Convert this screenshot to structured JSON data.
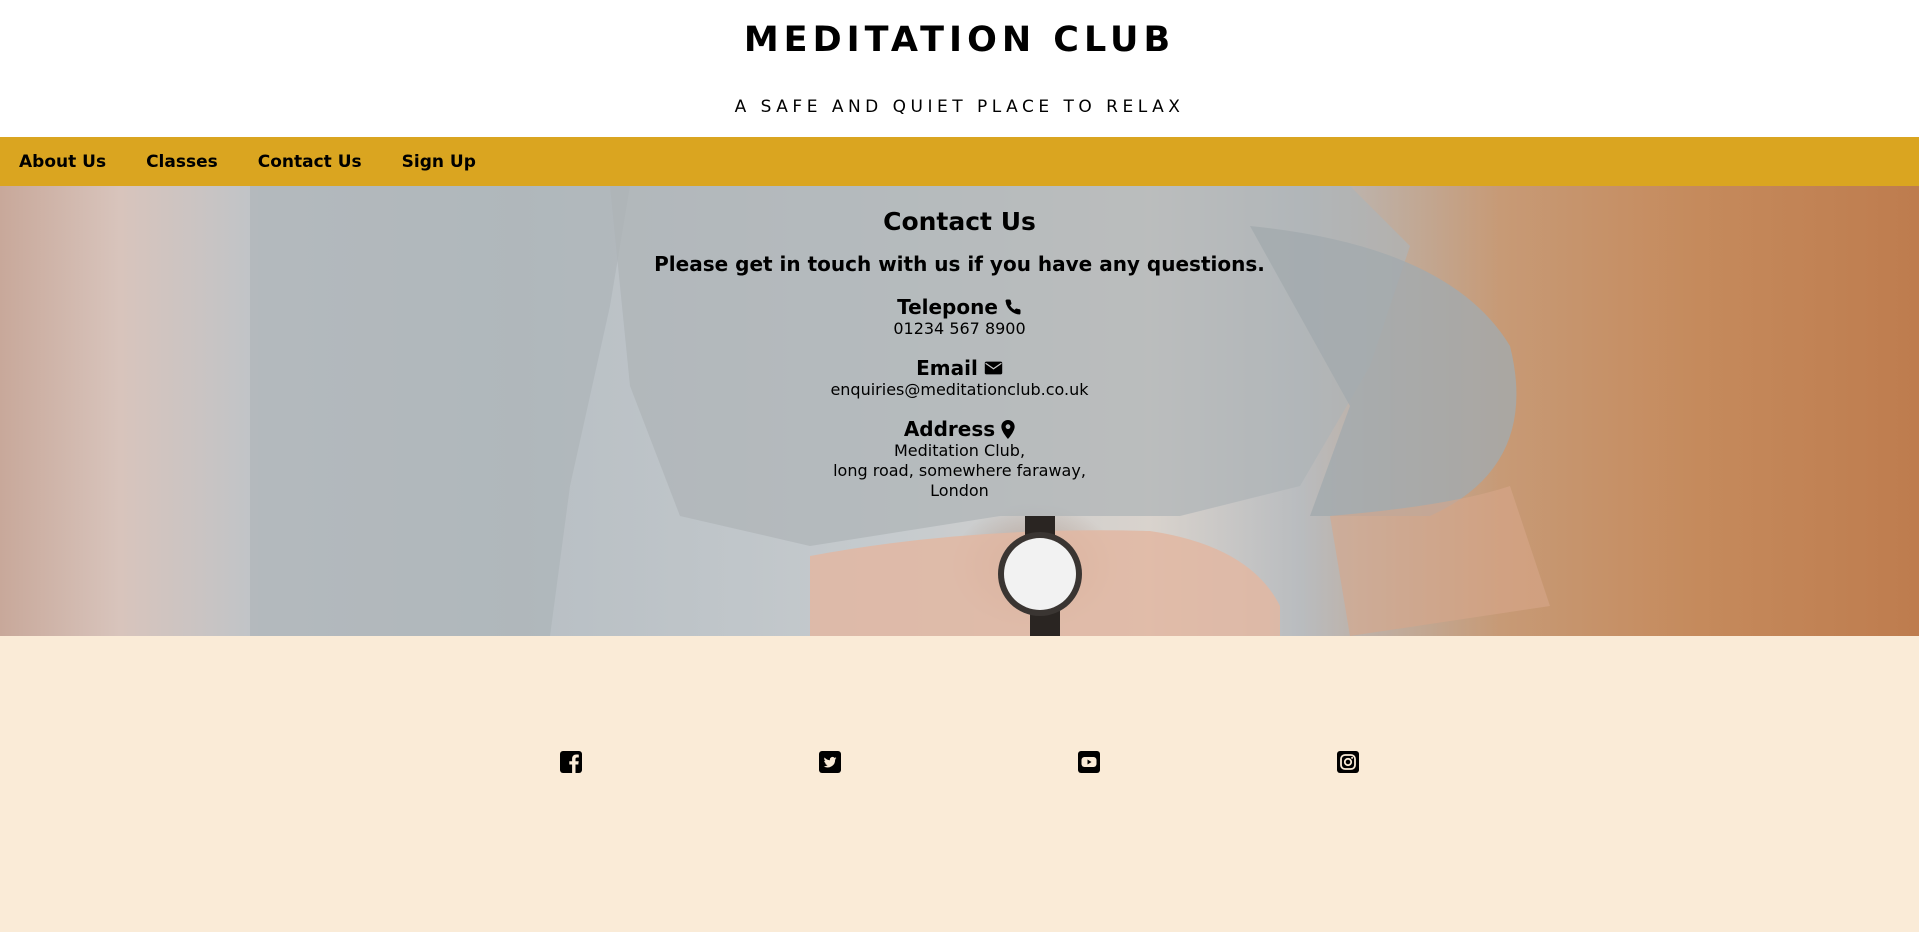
{
  "header": {
    "title": "MEDITATION CLUB",
    "tagline": "A SAFE AND QUIET PLACE TO RELAX"
  },
  "nav": {
    "items": [
      {
        "label": "About Us"
      },
      {
        "label": "Classes"
      },
      {
        "label": "Contact Us"
      },
      {
        "label": "Sign Up"
      }
    ],
    "background_color": "#daa520"
  },
  "contact": {
    "heading": "Contact Us",
    "intro": "Please get in touch with us if you have any questions.",
    "telephone": {
      "label": "Telepone",
      "icon": "phone-icon",
      "value": "01234 567 8900"
    },
    "email": {
      "label": "Email",
      "icon": "envelope-icon",
      "value": "enquiries@meditationclub.co.uk"
    },
    "address": {
      "label": "Address",
      "icon": "map-marker-icon",
      "lines": [
        "Meditation Club,",
        "long road, somewhere faraway,",
        "London"
      ]
    }
  },
  "footer": {
    "background_color": "#faebd7",
    "social": [
      "facebook-icon",
      "twitter-icon",
      "youtube-icon",
      "instagram-icon"
    ]
  }
}
